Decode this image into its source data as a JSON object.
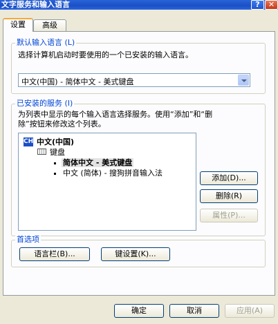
{
  "window": {
    "title": "文字服务和输入语言",
    "help_glyph": "?",
    "close_glyph": "✕"
  },
  "tabs": [
    {
      "label": "设置",
      "active": true
    },
    {
      "label": "高级",
      "active": false
    }
  ],
  "default_language": {
    "legend": "默认输入语言 (L)",
    "description": "选择计算机启动时要使用的一个已安装的输入语言。",
    "selected_value": "中文(中国) - 简体中文 - 美式键盘"
  },
  "installed_services": {
    "legend": "已安装的服务 (I)",
    "description_line1": "为列表中显示的每个输入语言选择服务。使用“添加”和“删",
    "description_line2": "除”按钮来修改这个列表。",
    "tree": {
      "language_badge": "CH",
      "language": "中文(中国)",
      "category": "键盘",
      "items": [
        "简体中文 - 美式键盘",
        "中文 (简体) - 搜狗拼音输入法"
      ]
    },
    "buttons": {
      "add": "添加(D)...",
      "remove": "删除(R)",
      "properties": "属性(P)..."
    }
  },
  "preferences": {
    "legend": "首选项",
    "language_bar_button": "语言栏(B)...",
    "key_settings_button": "键设置(K)..."
  },
  "footer": {
    "ok": "确定",
    "cancel": "取消",
    "apply": "应用(A)"
  },
  "colors": {
    "titlebar": "#1b4fc6",
    "dialog_bg": "#ece9d8",
    "legend_text": "#0046d5",
    "active_tab_accent": "#f5a93a"
  }
}
